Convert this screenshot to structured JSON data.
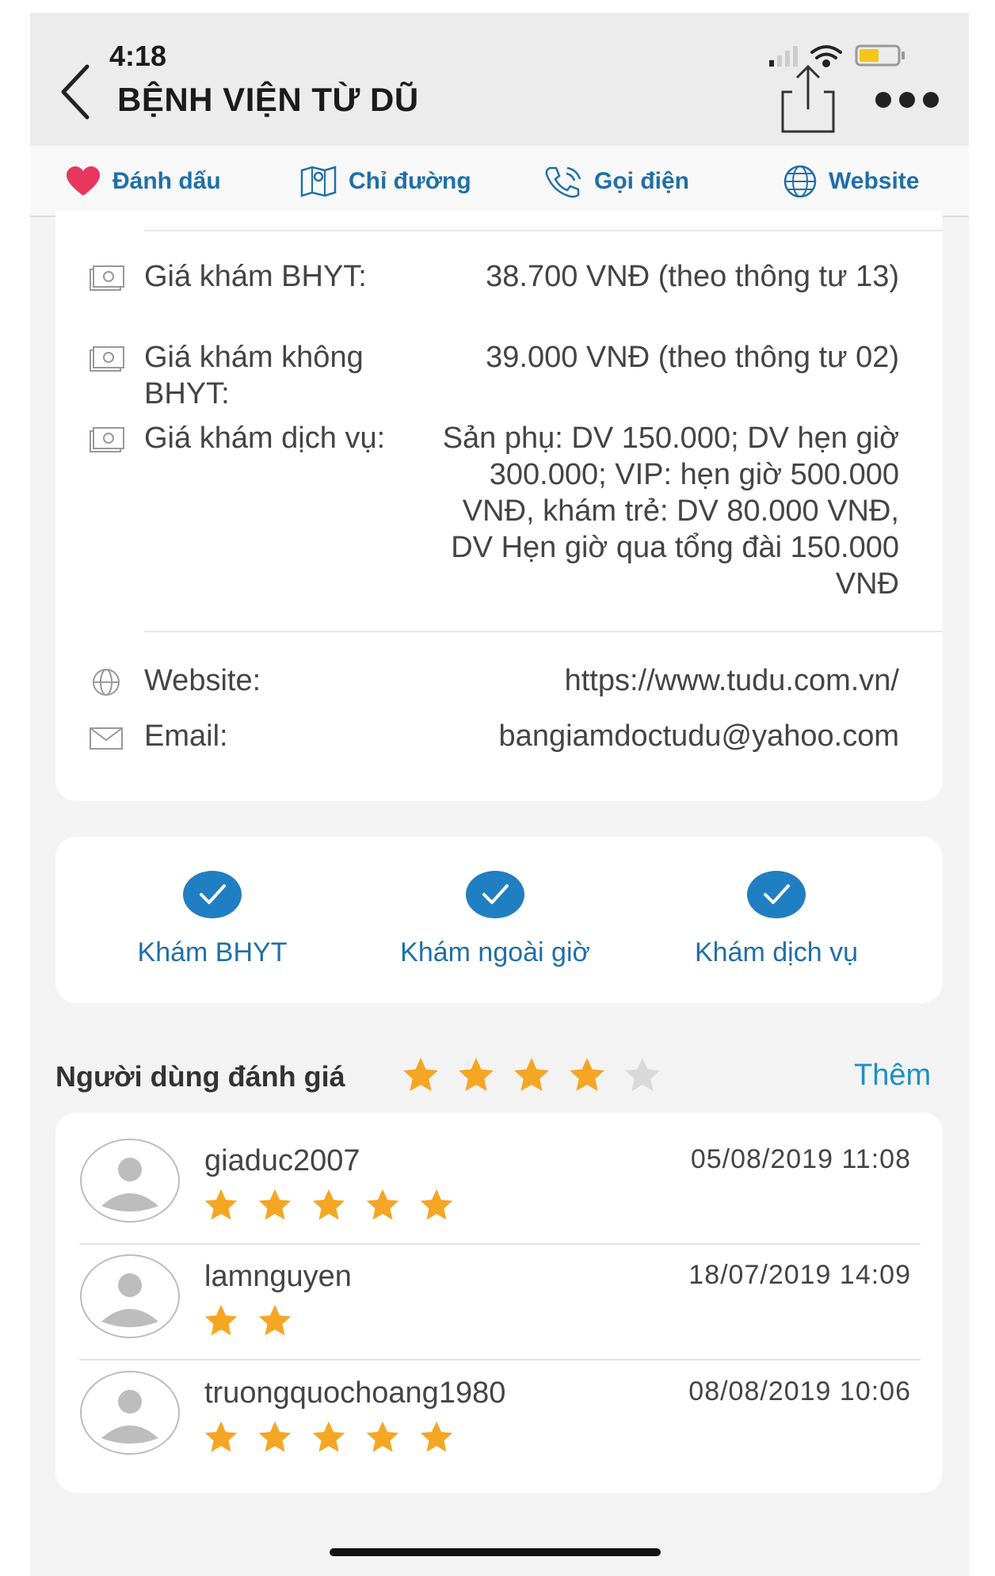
{
  "status_bar": {
    "time": "4:18"
  },
  "header": {
    "title": "BỆNH VIỆN TỪ DŨ"
  },
  "actions": {
    "bookmark": "Đánh dấu",
    "directions": "Chỉ đường",
    "call": "Gọi điện",
    "website": "Website"
  },
  "info": {
    "rows": [
      {
        "label": "Giá khám BHYT:",
        "value": "38.700 VNĐ (theo thông tư 13)"
      },
      {
        "label": "Giá khám không BHYT:",
        "value": "39.000 VNĐ (theo thông tư 02)"
      },
      {
        "label": "Giá khám dịch vụ:",
        "value": "Sản phụ: DV 150.000; DV hẹn giờ 300.000; VIP: hẹn giờ 500.000 VNĐ, khám trẻ: DV 80.000 VNĐ, DV Hẹn giờ qua tổng đài 150.000 VNĐ"
      },
      {
        "label": "Website:",
        "value": "https://www.tudu.com.vn/"
      },
      {
        "label": "Email:",
        "value": "bangiamdoctudu@yahoo.com"
      }
    ]
  },
  "services": [
    "Khám BHYT",
    "Khám ngoài giờ",
    "Khám dịch vụ"
  ],
  "ratings": {
    "header": "Người dùng đánh giá",
    "average_stars": 4,
    "max_stars": 5,
    "more_link": "Thêm",
    "reviews": [
      {
        "user": "giaduc2007",
        "date": "05/08/2019 11:08",
        "stars": 5
      },
      {
        "user": "lamnguyen",
        "date": "18/07/2019 14:09",
        "stars": 2
      },
      {
        "user": "truongquochoang1980",
        "date": "08/08/2019 10:06",
        "stars": 5
      }
    ]
  },
  "colors": {
    "accent": "#1f6fa8",
    "star": "#f5a623",
    "star_empty": "#d9d9d9",
    "heart": "#e8365d",
    "check": "#1f7fc2"
  }
}
